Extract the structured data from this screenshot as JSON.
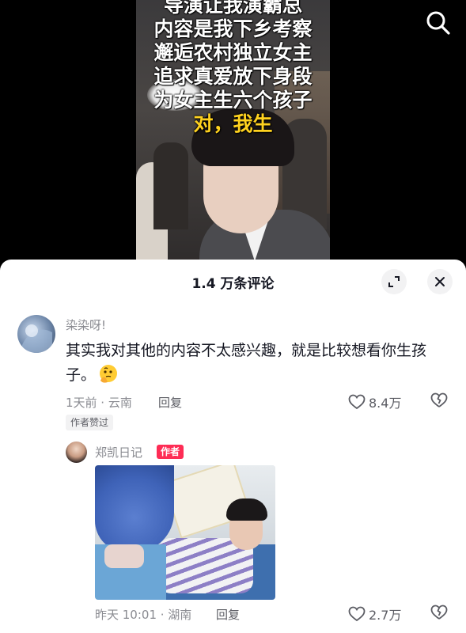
{
  "video": {
    "caption_lines": [
      "导演让我演霸总",
      "内容是我下乡考察",
      "邂逅农村独立女主",
      "追求真爱放下身段",
      "为女主生六个孩子"
    ],
    "caption_highlight": "对，我生",
    "search_icon": "search-icon"
  },
  "panel": {
    "title": "1.4 万条评论",
    "expand_icon": "expand-icon",
    "close_icon": "close-icon"
  },
  "comments": [
    {
      "username": "染染呀!",
      "text": "其实我对其他的内容不太感兴趣，就是比较想看你生孩子。",
      "emoji": "thinking-face-emoji",
      "meta": "1天前 · 云南",
      "reply": "回复",
      "likes": "8.4万",
      "badge": "作者赞过"
    },
    {
      "username": "郑凯日记",
      "author_tag": "作者",
      "meta": "昨天 10:01 · 湖南",
      "reply": "回复",
      "likes": "2.7万"
    }
  ],
  "colors": {
    "accent": "#fe2c55",
    "caption_highlight": "#ffd21f",
    "secondary_text": "#8a8b91",
    "primary_text": "#161823"
  }
}
